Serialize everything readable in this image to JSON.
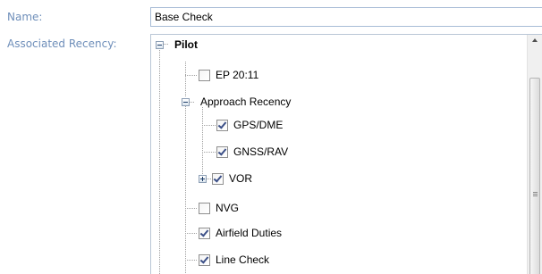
{
  "form": {
    "name_label": "Name:",
    "name_value": "Base Check",
    "recency_label": "Associated Recency:"
  },
  "tree": {
    "root": {
      "label": "Pilot",
      "expanded": true
    },
    "items": [
      {
        "label": "EP 20:11",
        "checked": false
      },
      {
        "label": "Approach Recency",
        "expanded": true
      },
      {
        "label": "GPS/DME",
        "checked": true
      },
      {
        "label": "GNSS/RAV",
        "checked": true
      },
      {
        "label": "VOR",
        "checked": true,
        "expanded": false
      },
      {
        "label": "NVG",
        "checked": false
      },
      {
        "label": "Airfield Duties",
        "checked": true
      },
      {
        "label": "Line Check",
        "checked": true
      }
    ]
  },
  "colors": {
    "label_text": "#6f8fba",
    "input_border": "#a7bcd6",
    "checkmark": "#3b4f87"
  }
}
